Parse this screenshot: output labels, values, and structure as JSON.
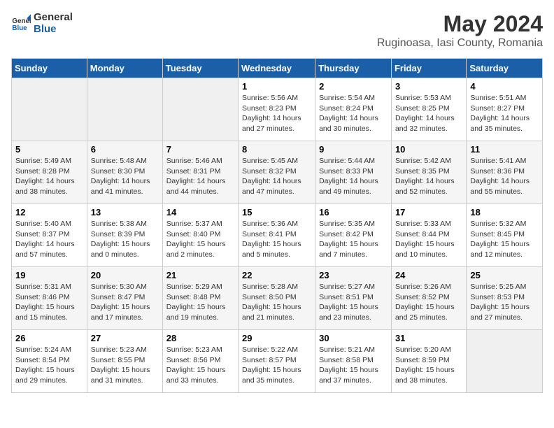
{
  "logo": {
    "line1": "General",
    "line2": "Blue"
  },
  "title": "May 2024",
  "subtitle": "Ruginoasa, Iasi County, Romania",
  "days_of_week": [
    "Sunday",
    "Monday",
    "Tuesday",
    "Wednesday",
    "Thursday",
    "Friday",
    "Saturday"
  ],
  "weeks": [
    [
      {
        "day": "",
        "sunrise": "",
        "sunset": "",
        "daylight": ""
      },
      {
        "day": "",
        "sunrise": "",
        "sunset": "",
        "daylight": ""
      },
      {
        "day": "",
        "sunrise": "",
        "sunset": "",
        "daylight": ""
      },
      {
        "day": "1",
        "sunrise": "Sunrise: 5:56 AM",
        "sunset": "Sunset: 8:23 PM",
        "daylight": "Daylight: 14 hours and 27 minutes."
      },
      {
        "day": "2",
        "sunrise": "Sunrise: 5:54 AM",
        "sunset": "Sunset: 8:24 PM",
        "daylight": "Daylight: 14 hours and 30 minutes."
      },
      {
        "day": "3",
        "sunrise": "Sunrise: 5:53 AM",
        "sunset": "Sunset: 8:25 PM",
        "daylight": "Daylight: 14 hours and 32 minutes."
      },
      {
        "day": "4",
        "sunrise": "Sunrise: 5:51 AM",
        "sunset": "Sunset: 8:27 PM",
        "daylight": "Daylight: 14 hours and 35 minutes."
      }
    ],
    [
      {
        "day": "5",
        "sunrise": "Sunrise: 5:49 AM",
        "sunset": "Sunset: 8:28 PM",
        "daylight": "Daylight: 14 hours and 38 minutes."
      },
      {
        "day": "6",
        "sunrise": "Sunrise: 5:48 AM",
        "sunset": "Sunset: 8:30 PM",
        "daylight": "Daylight: 14 hours and 41 minutes."
      },
      {
        "day": "7",
        "sunrise": "Sunrise: 5:46 AM",
        "sunset": "Sunset: 8:31 PM",
        "daylight": "Daylight: 14 hours and 44 minutes."
      },
      {
        "day": "8",
        "sunrise": "Sunrise: 5:45 AM",
        "sunset": "Sunset: 8:32 PM",
        "daylight": "Daylight: 14 hours and 47 minutes."
      },
      {
        "day": "9",
        "sunrise": "Sunrise: 5:44 AM",
        "sunset": "Sunset: 8:33 PM",
        "daylight": "Daylight: 14 hours and 49 minutes."
      },
      {
        "day": "10",
        "sunrise": "Sunrise: 5:42 AM",
        "sunset": "Sunset: 8:35 PM",
        "daylight": "Daylight: 14 hours and 52 minutes."
      },
      {
        "day": "11",
        "sunrise": "Sunrise: 5:41 AM",
        "sunset": "Sunset: 8:36 PM",
        "daylight": "Daylight: 14 hours and 55 minutes."
      }
    ],
    [
      {
        "day": "12",
        "sunrise": "Sunrise: 5:40 AM",
        "sunset": "Sunset: 8:37 PM",
        "daylight": "Daylight: 14 hours and 57 minutes."
      },
      {
        "day": "13",
        "sunrise": "Sunrise: 5:38 AM",
        "sunset": "Sunset: 8:39 PM",
        "daylight": "Daylight: 15 hours and 0 minutes."
      },
      {
        "day": "14",
        "sunrise": "Sunrise: 5:37 AM",
        "sunset": "Sunset: 8:40 PM",
        "daylight": "Daylight: 15 hours and 2 minutes."
      },
      {
        "day": "15",
        "sunrise": "Sunrise: 5:36 AM",
        "sunset": "Sunset: 8:41 PM",
        "daylight": "Daylight: 15 hours and 5 minutes."
      },
      {
        "day": "16",
        "sunrise": "Sunrise: 5:35 AM",
        "sunset": "Sunset: 8:42 PM",
        "daylight": "Daylight: 15 hours and 7 minutes."
      },
      {
        "day": "17",
        "sunrise": "Sunrise: 5:33 AM",
        "sunset": "Sunset: 8:44 PM",
        "daylight": "Daylight: 15 hours and 10 minutes."
      },
      {
        "day": "18",
        "sunrise": "Sunrise: 5:32 AM",
        "sunset": "Sunset: 8:45 PM",
        "daylight": "Daylight: 15 hours and 12 minutes."
      }
    ],
    [
      {
        "day": "19",
        "sunrise": "Sunrise: 5:31 AM",
        "sunset": "Sunset: 8:46 PM",
        "daylight": "Daylight: 15 hours and 15 minutes."
      },
      {
        "day": "20",
        "sunrise": "Sunrise: 5:30 AM",
        "sunset": "Sunset: 8:47 PM",
        "daylight": "Daylight: 15 hours and 17 minutes."
      },
      {
        "day": "21",
        "sunrise": "Sunrise: 5:29 AM",
        "sunset": "Sunset: 8:48 PM",
        "daylight": "Daylight: 15 hours and 19 minutes."
      },
      {
        "day": "22",
        "sunrise": "Sunrise: 5:28 AM",
        "sunset": "Sunset: 8:50 PM",
        "daylight": "Daylight: 15 hours and 21 minutes."
      },
      {
        "day": "23",
        "sunrise": "Sunrise: 5:27 AM",
        "sunset": "Sunset: 8:51 PM",
        "daylight": "Daylight: 15 hours and 23 minutes."
      },
      {
        "day": "24",
        "sunrise": "Sunrise: 5:26 AM",
        "sunset": "Sunset: 8:52 PM",
        "daylight": "Daylight: 15 hours and 25 minutes."
      },
      {
        "day": "25",
        "sunrise": "Sunrise: 5:25 AM",
        "sunset": "Sunset: 8:53 PM",
        "daylight": "Daylight: 15 hours and 27 minutes."
      }
    ],
    [
      {
        "day": "26",
        "sunrise": "Sunrise: 5:24 AM",
        "sunset": "Sunset: 8:54 PM",
        "daylight": "Daylight: 15 hours and 29 minutes."
      },
      {
        "day": "27",
        "sunrise": "Sunrise: 5:23 AM",
        "sunset": "Sunset: 8:55 PM",
        "daylight": "Daylight: 15 hours and 31 minutes."
      },
      {
        "day": "28",
        "sunrise": "Sunrise: 5:23 AM",
        "sunset": "Sunset: 8:56 PM",
        "daylight": "Daylight: 15 hours and 33 minutes."
      },
      {
        "day": "29",
        "sunrise": "Sunrise: 5:22 AM",
        "sunset": "Sunset: 8:57 PM",
        "daylight": "Daylight: 15 hours and 35 minutes."
      },
      {
        "day": "30",
        "sunrise": "Sunrise: 5:21 AM",
        "sunset": "Sunset: 8:58 PM",
        "daylight": "Daylight: 15 hours and 37 minutes."
      },
      {
        "day": "31",
        "sunrise": "Sunrise: 5:20 AM",
        "sunset": "Sunset: 8:59 PM",
        "daylight": "Daylight: 15 hours and 38 minutes."
      },
      {
        "day": "",
        "sunrise": "",
        "sunset": "",
        "daylight": ""
      }
    ]
  ]
}
